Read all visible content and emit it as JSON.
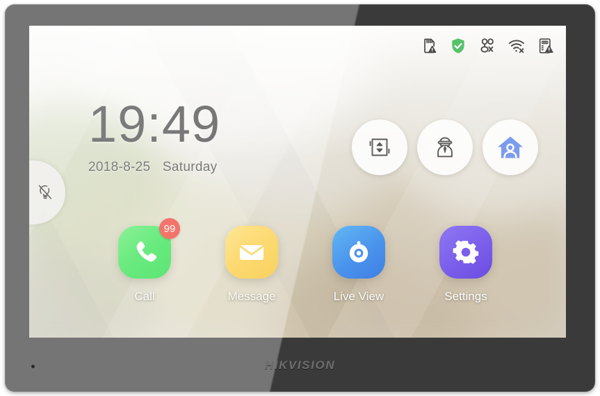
{
  "device": {
    "brand": "HIKVISION",
    "mic_label": "microphone-dot"
  },
  "statusbar": {
    "icons": [
      {
        "name": "sd-card-warning-icon",
        "label": "SD Card Error",
        "color": "#4a4a4a"
      },
      {
        "name": "shield-check-icon",
        "label": "Protected",
        "color": "#56c26a"
      },
      {
        "name": "contacts-offline-icon",
        "label": "Indoor Extension Offline",
        "color": "#4a4a4a"
      },
      {
        "name": "wifi-disconnected-icon",
        "label": "Wi-Fi Disconnected",
        "color": "#4a4a4a"
      },
      {
        "name": "door-station-warning-icon",
        "label": "Door Station Error",
        "color": "#4a4a4a"
      }
    ]
  },
  "clock": {
    "time": "19:49",
    "date": "2018-8-25",
    "day_of_week": "Saturday"
  },
  "shortcuts": [
    {
      "name": "elevator-button",
      "label": "Elevator",
      "icon": "elevator-icon"
    },
    {
      "name": "concierge-button",
      "label": "Security Guard",
      "icon": "guard-icon"
    },
    {
      "name": "arming-mode-button",
      "label": "Stay Mode",
      "icon": "home-person-icon",
      "color": "#7b9ced"
    }
  ],
  "apps": [
    {
      "name": "call-app",
      "label": "Call",
      "icon": "phone-icon",
      "badge": "99",
      "badge_color": "#f2685f",
      "color": "#5ce873"
    },
    {
      "name": "message-app",
      "label": "Message",
      "icon": "envelope-icon",
      "badge": "",
      "color": "#fcd96f"
    },
    {
      "name": "live-view-app",
      "label": "Live View",
      "icon": "camera-icon",
      "badge": "",
      "color": "#4a93ec"
    },
    {
      "name": "settings-app",
      "label": "Settings",
      "icon": "gear-icon",
      "badge": "",
      "color": "#7b5eea"
    }
  ],
  "left_tab": {
    "name": "light-off-tab",
    "label": "Light Off",
    "icon": "bulb-off-icon"
  }
}
